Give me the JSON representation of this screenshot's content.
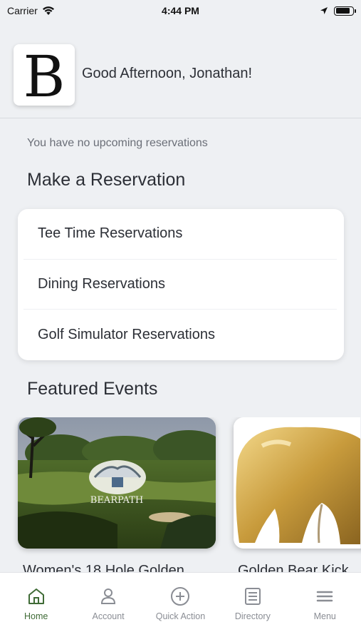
{
  "status_bar": {
    "carrier": "Carrier",
    "time": "4:44 PM",
    "battery_level": 0.85
  },
  "header": {
    "logo_letter": "B",
    "greeting": "Good Afternoon, Jonathan!"
  },
  "reservations": {
    "empty_message": "You have no upcoming reservations",
    "section_title": "Make a Reservation",
    "items": [
      {
        "label": "Tee Time Reservations"
      },
      {
        "label": "Dining Reservations"
      },
      {
        "label": "Golf Simulator Reservations"
      }
    ]
  },
  "featured": {
    "section_title": "Featured Events",
    "events": [
      {
        "title": "Women's 18 Hole Golden",
        "image_text": "BEARPATH"
      },
      {
        "title": "Golden Bear Kick"
      }
    ]
  },
  "tab_bar": {
    "tabs": [
      {
        "label": "Home",
        "icon": "home-icon"
      },
      {
        "label": "Account",
        "icon": "account-icon"
      },
      {
        "label": "Quick Action",
        "icon": "plus-circle-icon"
      },
      {
        "label": "Directory",
        "icon": "directory-icon"
      },
      {
        "label": "Menu",
        "icon": "menu-icon"
      }
    ],
    "active_color": "#3f6b36",
    "inactive_color": "#8a8d94"
  }
}
